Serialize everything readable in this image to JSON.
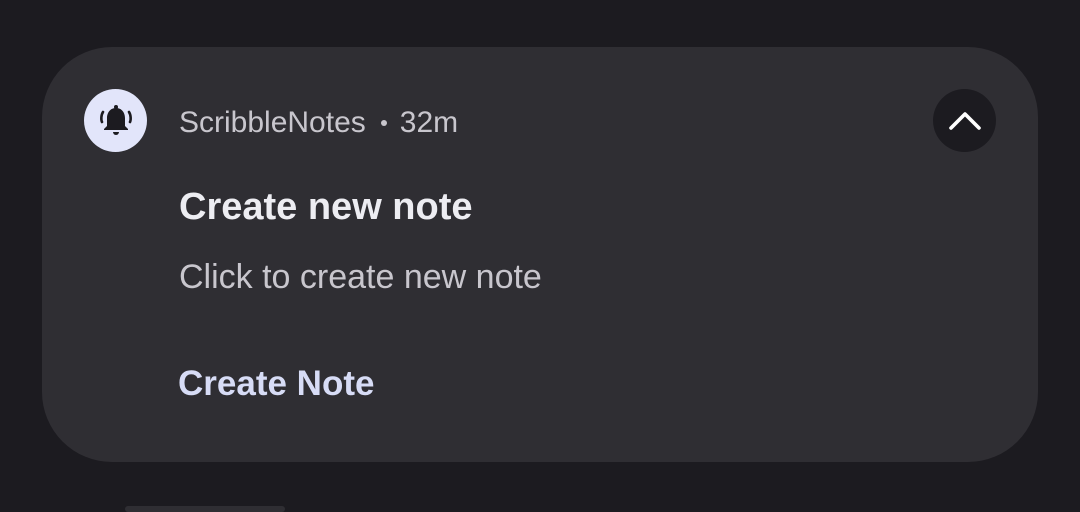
{
  "notification": {
    "app_name": "ScribbleNotes",
    "time": "32m",
    "title": "Create new note",
    "body": "Click to create new note",
    "action_label": "Create Note",
    "app_icon": "bell-icon",
    "expand_icon": "chevron-up-icon"
  },
  "colors": {
    "background": "#1c1b20",
    "card": "#2f2e33",
    "icon_bg": "#e2e5fa",
    "accent": "#d7dcf6"
  }
}
